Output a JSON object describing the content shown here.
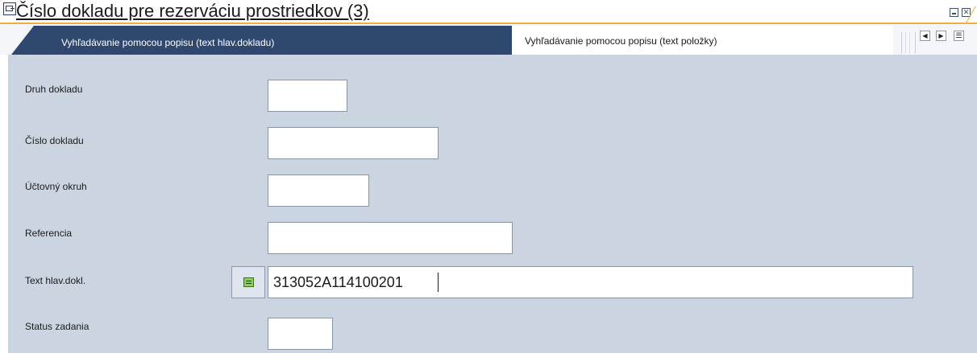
{
  "window": {
    "title": "Číslo dokladu pre rezerváciu prostriedkov (3)",
    "minimize_glyph": "",
    "close_glyph": "✕",
    "accent_color": "#f0b040"
  },
  "tabs": [
    {
      "label": "Vyhľadávanie pomocou popisu (text hlav.dokladu)",
      "active": true
    },
    {
      "label": "Vyhľadávanie pomocou popisu (text položky)",
      "active": false
    }
  ],
  "tab_nav": {
    "prev_glyph": "◀",
    "next_glyph": "▶",
    "list_glyph": "☰"
  },
  "fields": {
    "druh_dokladu": {
      "label": "Druh dokladu",
      "value": ""
    },
    "cislo_dokladu": {
      "label": "Číslo dokladu",
      "value": ""
    },
    "uctovny_okruh": {
      "label": "Účtovný okruh",
      "value": ""
    },
    "referencia": {
      "label": "Referencia",
      "value": ""
    },
    "text_hlav_dokl": {
      "label": "Text hlav.dokl.",
      "value": "313052A114100201",
      "operator_icon": "equals-icon"
    },
    "status_zadania": {
      "label": "Status zadania",
      "value": ""
    }
  },
  "colors": {
    "active_tab": "#2f4870",
    "panel_background": "#cbd5e1"
  }
}
